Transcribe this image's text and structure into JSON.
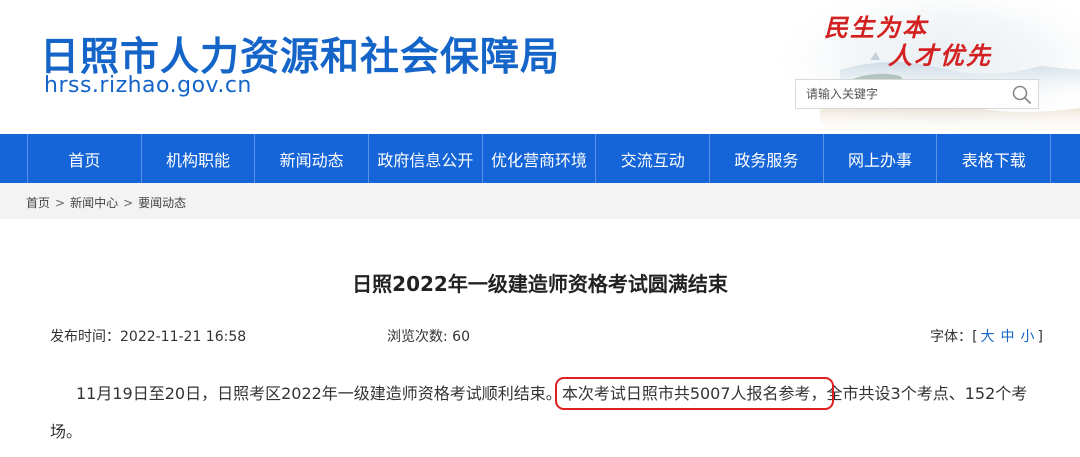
{
  "header": {
    "site_title": "日照市人力资源和社会保障局",
    "site_domain": "hrss.rizhao.gov.cn",
    "slogan_line1": "民生为本",
    "slogan_line2": "人才优先",
    "search_placeholder": "请输入关键字",
    "brand_color": "#1565c9",
    "slogan_color": "#d32020"
  },
  "nav": {
    "items": [
      "首页",
      "机构职能",
      "新闻动态",
      "政府信息公开",
      "优化营商环境",
      "交流互动",
      "政务服务",
      "网上办事",
      "表格下载"
    ],
    "background": "#1565d8"
  },
  "breadcrumb": {
    "items": [
      "首页",
      "新闻中心",
      "要闻动态"
    ],
    "separator": ">"
  },
  "article": {
    "title": "日照2022年一级建造师资格考试圆满结束",
    "date_label": "发布时间：",
    "date_value": "2022-11-21 16:58",
    "views_label": "浏览次数: ",
    "views_value": "60",
    "font_label": "字体：",
    "font_open": "[",
    "font_sizes": [
      "大",
      "中",
      "小"
    ],
    "font_close": "]",
    "paragraph_before": "11月19日至20日，日照考区2022年一级建造师资格考试顺利结束。",
    "paragraph_highlight": "本次考试日照市共5007人报名参考，",
    "paragraph_after": "全市共设3个考点、152个考场。",
    "highlight_color": "#e02020"
  }
}
